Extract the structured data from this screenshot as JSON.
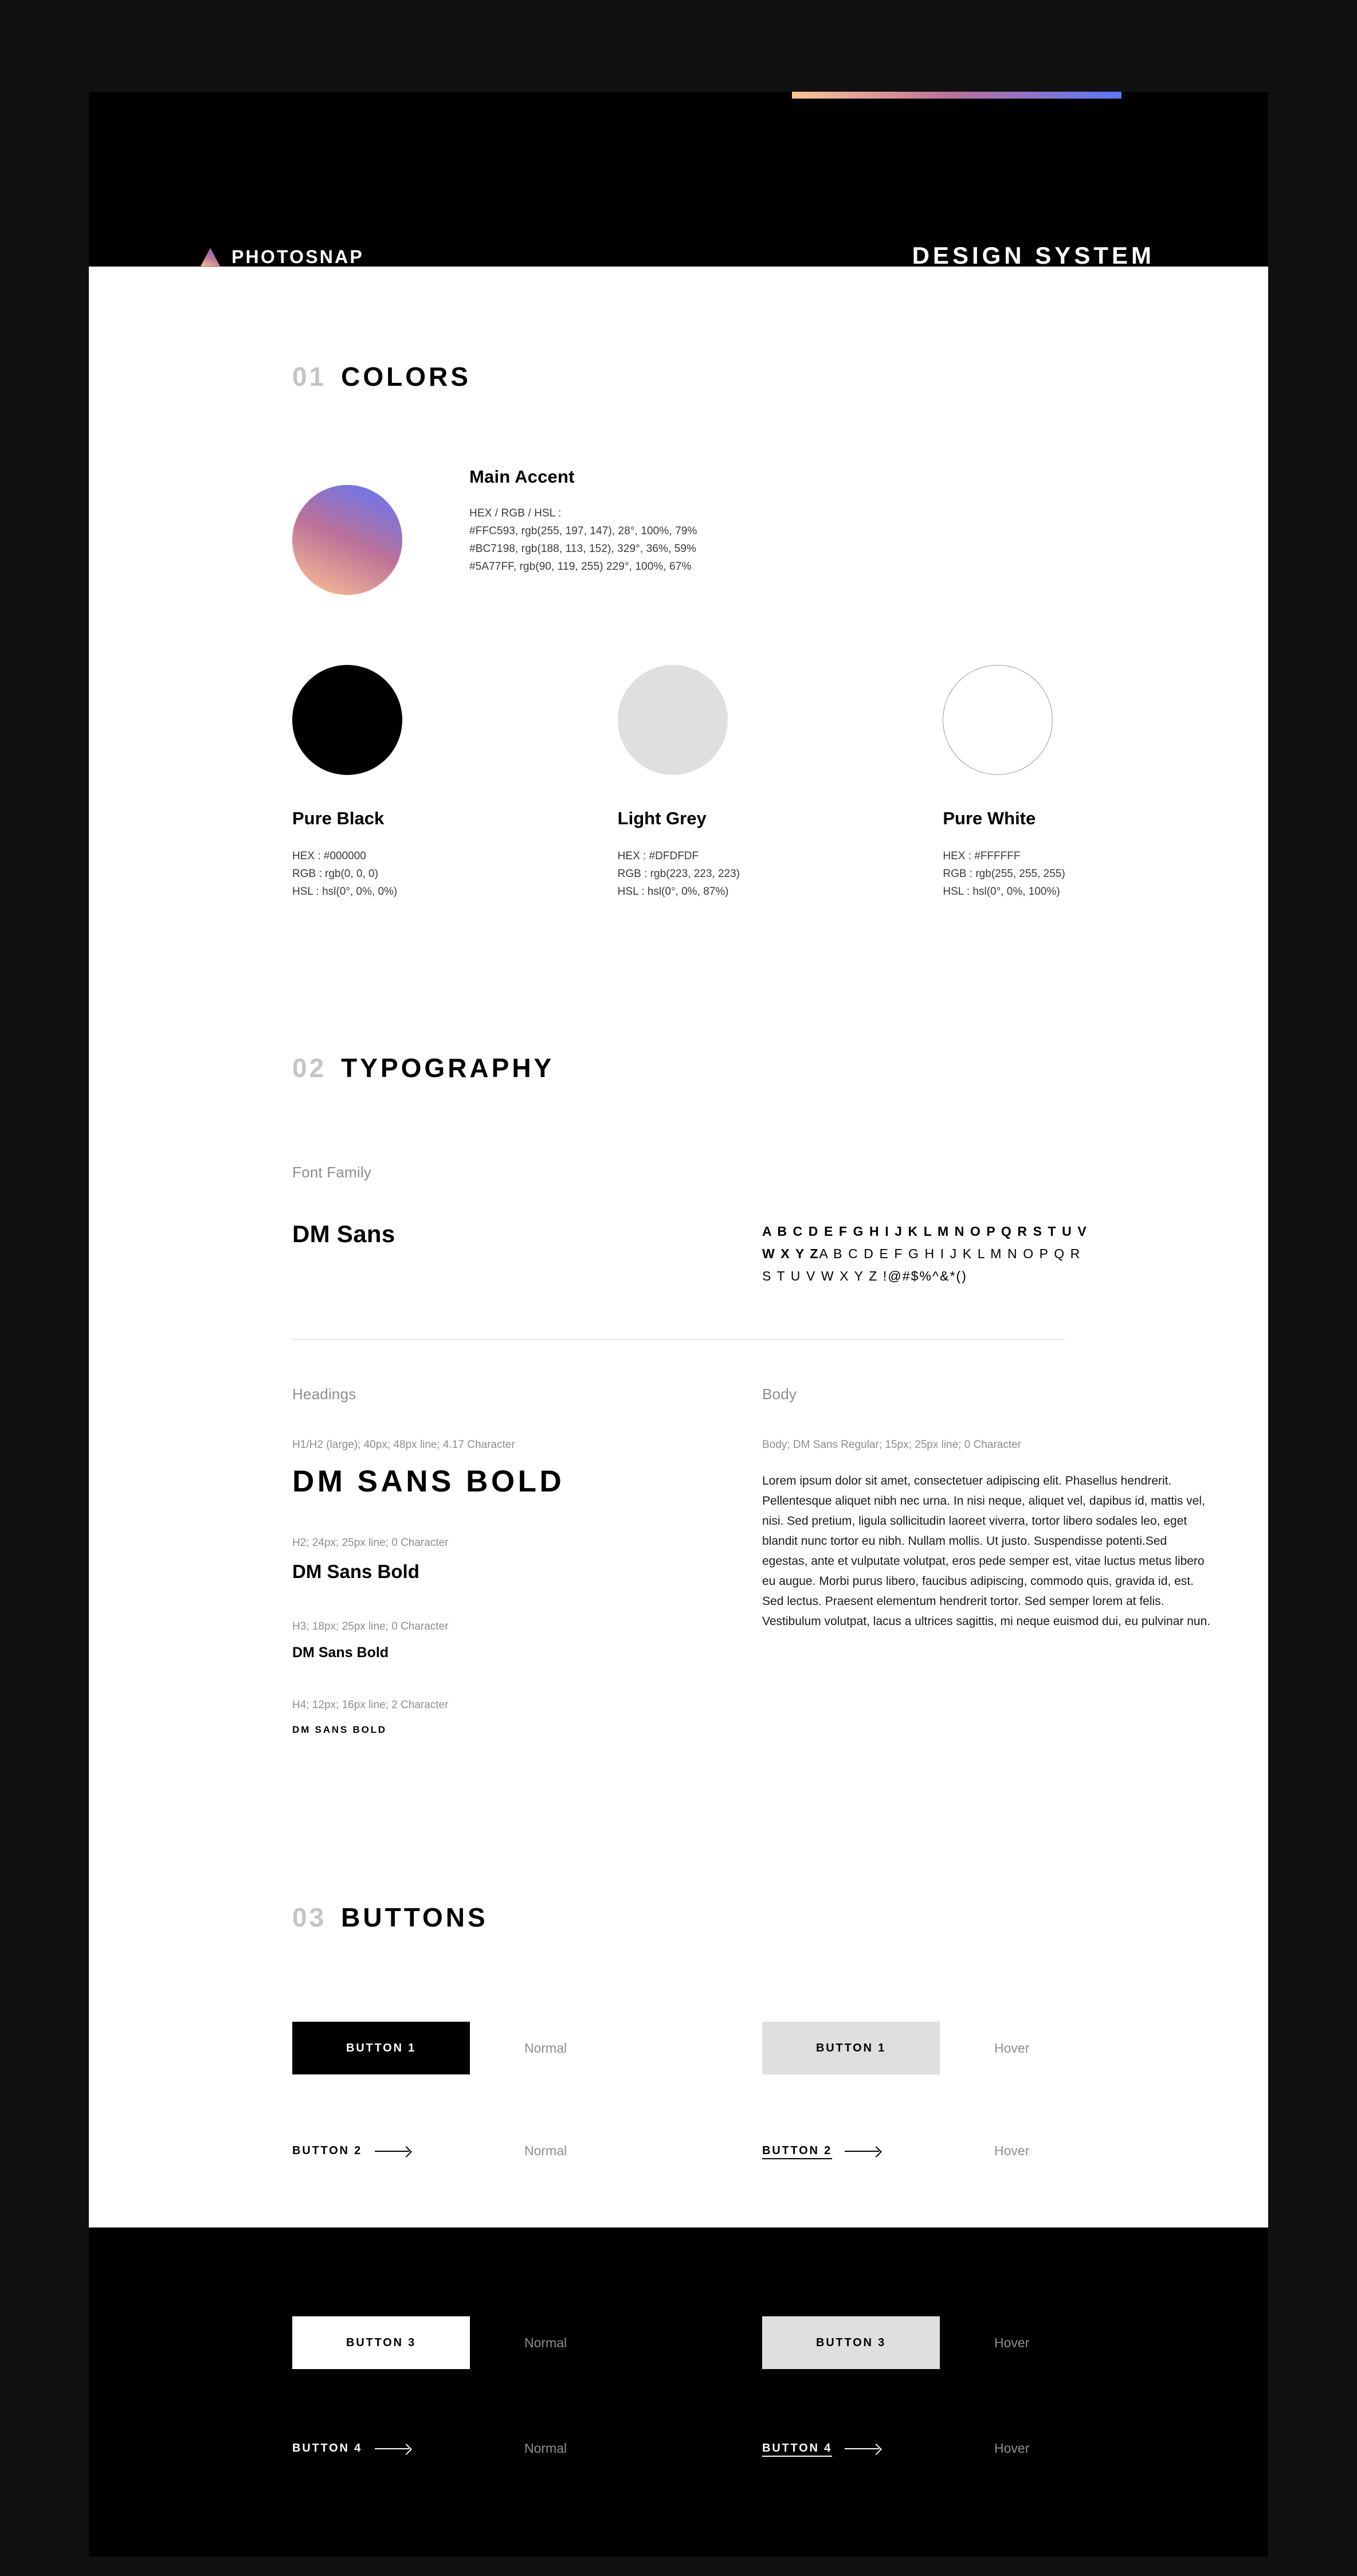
{
  "header": {
    "brand_name": "PHOTOSNAP",
    "title": "DESIGN SYSTEM",
    "gradient": [
      "#FFC593",
      "#BC7198",
      "#5A77FF"
    ]
  },
  "colors_section": {
    "number": "01",
    "title": "COLORS",
    "accent": {
      "name": "Main Accent",
      "label": "HEX / RGB / HSL :",
      "values": [
        "#FFC593,  rgb(255, 197, 147), 28°, 100%, 79%",
        "#BC7198,  rgb(188, 113, 152), 329°, 36%, 59%",
        "#5A77FF,  rgb(90, 119, 255) 229°, 100%, 67%"
      ]
    },
    "swatches": [
      {
        "name": "Pure Black",
        "hex_line": "HEX : #000000",
        "rgb_line": "RGB : rgb(0, 0, 0)",
        "hsl_line": "HSL : hsl(0°, 0%, 0%)",
        "color": "#000000"
      },
      {
        "name": "Light Grey",
        "hex_line": "HEX : #DFDFDF",
        "rgb_line": "RGB : rgb(223, 223, 223)",
        "hsl_line": "HSL : hsl(0°, 0%, 87%)",
        "color": "#DFDFDF"
      },
      {
        "name": "Pure White",
        "hex_line": "HEX : #FFFFFF",
        "rgb_line": "RGB : rgb(255, 255, 255)",
        "hsl_line": "HSL : hsl(0°, 0%, 100%)",
        "color": "#FFFFFF"
      }
    ]
  },
  "typography_section": {
    "number": "02",
    "title": "TYPOGRAPHY",
    "font_family_label": "Font Family",
    "font_name": "DM Sans",
    "glyph_lines": [
      "A B C D E F G H I J K L M N O P Q R S T U V",
      "W X Y Z",
      "A B C D E F G H I J K L M N O P Q R",
      "S T U V W X Y Z !@#$%^&*()"
    ],
    "headings_label": "Headings",
    "body_label": "Body",
    "headings": [
      {
        "meta": "H1/H2 (large); 40px; 48px line; 4.17 Character",
        "sample": "DM SANS BOLD"
      },
      {
        "meta": "H2; 24px; 25px line; 0 Character",
        "sample": "DM Sans Bold"
      },
      {
        "meta": "H3; 18px; 25px line; 0 Character",
        "sample": "DM Sans Bold"
      },
      {
        "meta": "H4; 12px; 16px line; 2 Character",
        "sample": "DM SANS BOLD"
      }
    ],
    "body_meta": "Body; DM Sans Regular; 15px; 25px line; 0 Character",
    "body_copy": "Lorem ipsum dolor sit amet, consectetuer adipiscing elit. Phasellus hendrerit. Pellentesque aliquet nibh nec urna. In nisi neque, aliquet vel, dapibus id, mattis vel, nisi. Sed pretium, ligula sollicitudin laoreet viverra, tortor libero sodales leo, eget blandit nunc tortor eu nibh. Nullam mollis. Ut justo. Suspendisse potenti.Sed egestas, ante et vulputate volutpat, eros pede semper est, vitae luctus metus libero eu augue. Morbi purus libero, faucibus adipiscing, commodo quis, gravida id, est. Sed lectus. Praesent elementum hendrerit tortor. Sed semper lorem at felis. Vestibulum volutpat, lacus a ultrices sagittis, mi neque euismod dui, eu pulvinar nun."
  },
  "buttons_section": {
    "number": "03",
    "title": "BUTTONS",
    "light": [
      {
        "label": "BUTTON 1",
        "state": "Normal",
        "style": "filled-dark"
      },
      {
        "label": "BUTTON 1",
        "state": "Hover",
        "style": "filled-grey"
      },
      {
        "label": "BUTTON 2",
        "state": "Normal",
        "style": "link"
      },
      {
        "label": "BUTTON 2",
        "state": "Hover",
        "style": "link-underline"
      }
    ],
    "dark": [
      {
        "label": "BUTTON 3",
        "state": "Normal",
        "style": "filled-white"
      },
      {
        "label": "BUTTON 3",
        "state": "Hover",
        "style": "filled-grey"
      },
      {
        "label": "BUTTON 4",
        "state": "Normal",
        "style": "link"
      },
      {
        "label": "BUTTON 4",
        "state": "Hover",
        "style": "link-underline"
      }
    ]
  }
}
